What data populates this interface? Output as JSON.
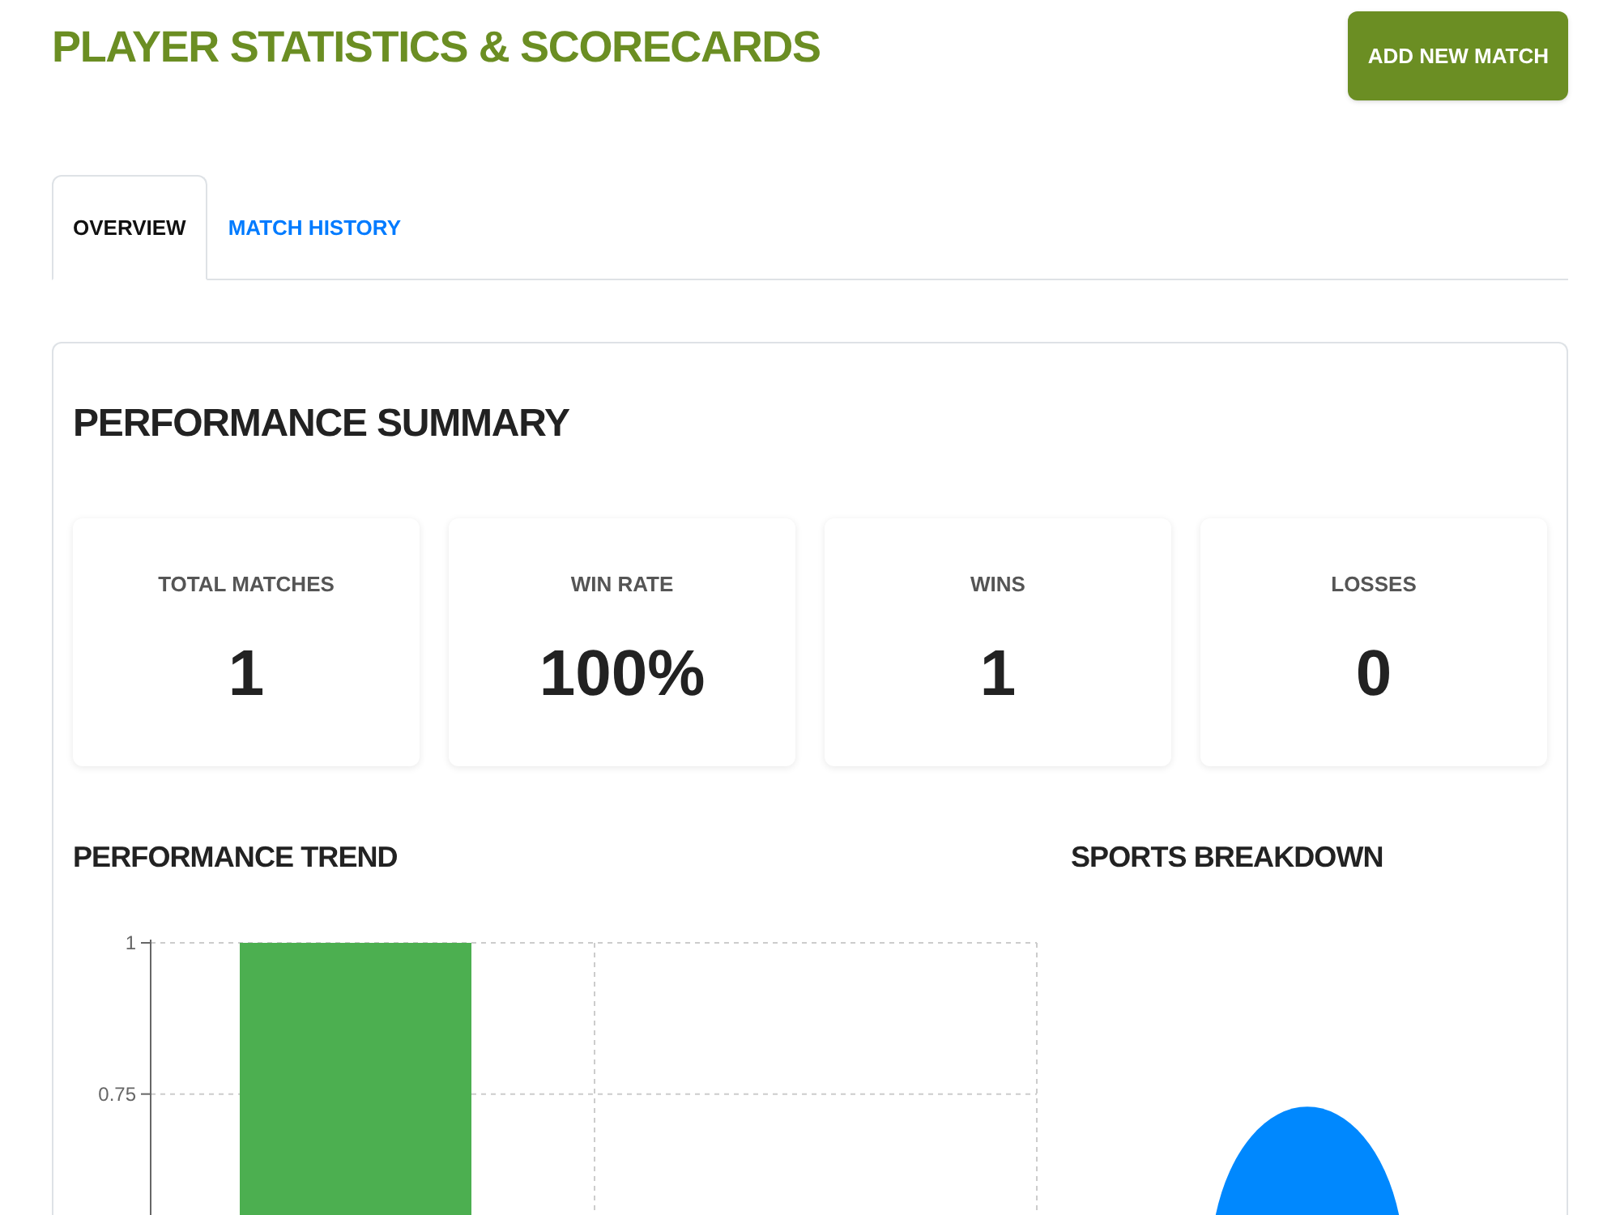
{
  "header": {
    "title": "PLAYER STATISTICS & SCORECARDS",
    "button": "ADD NEW MATCH"
  },
  "tabs": [
    {
      "label": "OVERVIEW",
      "selected": true
    },
    {
      "label": "MATCH HISTORY",
      "selected": false
    }
  ],
  "summary": {
    "title": "PERFORMANCE SUMMARY",
    "stats": [
      {
        "label": "TOTAL MATCHES",
        "value": "1"
      },
      {
        "label": "WIN RATE",
        "value": "100%"
      },
      {
        "label": "WINS",
        "value": "1"
      },
      {
        "label": "LOSSES",
        "value": "0"
      }
    ]
  },
  "trend": {
    "title": "PERFORMANCE TREND",
    "chart_data": {
      "type": "bar",
      "ylim": [
        0.55,
        1
      ],
      "yticks": [
        0.75,
        1
      ],
      "series": [
        {
          "color": "#4caf50",
          "values": [
            1
          ]
        }
      ]
    }
  },
  "sports": {
    "title": "SPORTS BREAKDOWN"
  }
}
